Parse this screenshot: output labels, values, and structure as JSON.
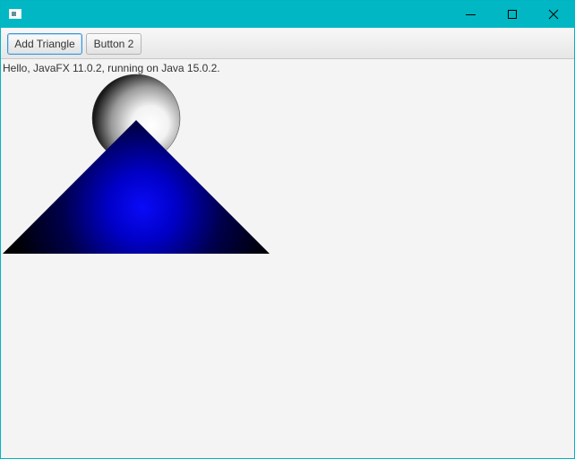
{
  "window": {
    "icon": "app-window-icon",
    "controls": [
      {
        "name": "minimize",
        "icon": "minimize-icon"
      },
      {
        "name": "maximize",
        "icon": "maximize-icon"
      },
      {
        "name": "close",
        "icon": "close-icon"
      }
    ],
    "title_bar_color": "#00b7c3"
  },
  "toolbar": {
    "add_triangle_label": "Add Triangle",
    "button2_label": "Button 2"
  },
  "content": {
    "status_text": "Hello, JavaFX 11.0.2, running on Java 15.0.2."
  },
  "colors": {
    "triangle_highlight": "#0000ff",
    "triangle_base": "#000000",
    "sphere_highlight": "#ffffff",
    "sphere_shadow": "#000000"
  }
}
